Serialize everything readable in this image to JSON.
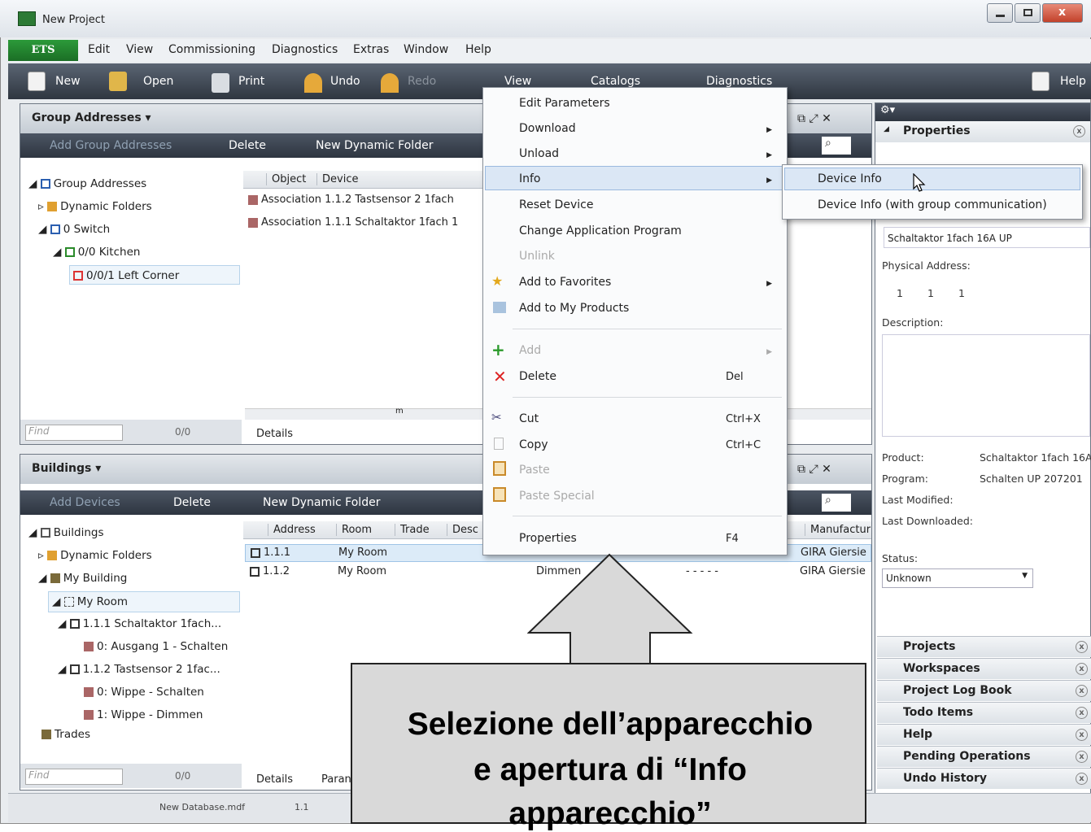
{
  "window": {
    "title": "New Project"
  },
  "menubar": {
    "ets": "ETS",
    "items": [
      "Edit",
      "View",
      "Commissioning",
      "Diagnostics",
      "Extras",
      "Window",
      "Help"
    ]
  },
  "toolbar": {
    "new": "New",
    "open": "Open",
    "print": "Print",
    "undo": "Undo",
    "redo": "Redo",
    "view": "View",
    "catalogs": "Catalogs",
    "diagnostics": "Diagnostics",
    "help": "Help"
  },
  "group_panel": {
    "title": "Group Addresses",
    "add": "Add Group Addresses",
    "delete": "Delete",
    "new_folder": "New Dynamic Folder",
    "tree": [
      "Group Addresses",
      "Dynamic Folders",
      "0 Switch",
      "0/0 Kitchen",
      "0/0/1 Left Corner"
    ],
    "columns": [
      "Object",
      "Device"
    ],
    "rows": [
      "Association 1.1.2  Tastsensor 2 1fach",
      "Association 1.1.1  Schaltaktor 1fach 1"
    ],
    "find": "Find",
    "count": "0/0",
    "tab": "Details",
    "scroll_mark": "m"
  },
  "buildings_panel": {
    "title": "Buildings",
    "add": "Add Devices",
    "delete": "Delete",
    "new_folder": "New Dynamic Folder",
    "tree": [
      "Buildings",
      "Dynamic Folders",
      "My Building",
      "My Room",
      "1.1.1  Schaltaktor 1fach...",
      "0: Ausgang 1 - Schalten",
      "1.1.2  Tastsensor 2 1fac...",
      "0: Wippe - Schalten",
      "1: Wippe - Dimmen",
      "Trades"
    ],
    "columns": [
      "Address",
      "Room",
      "Trade",
      "Desc",
      "Manufactur"
    ],
    "rows": [
      {
        "address": "1.1.1",
        "room": "My Room",
        "manufacturer": "GIRA Giersie"
      },
      {
        "address": "1.1.2",
        "room": "My Room",
        "desc": "Dimmen",
        "dashes": "-  -  -  -  -",
        "manufacturer": "GIRA Giersie"
      }
    ],
    "find": "Find",
    "count": "0/0",
    "tabs": [
      "Details",
      "Paran"
    ]
  },
  "context_menu": {
    "items": [
      "Edit Parameters",
      "Download",
      "Unload",
      "Info",
      "Reset Device",
      "Change Application Program",
      "Unlink",
      "Add to Favorites",
      "Add to My Products",
      "Add",
      "Delete",
      "Cut",
      "Copy",
      "Paste",
      "Paste Special",
      "Properties"
    ],
    "shortcuts": {
      "delete": "Del",
      "cut": "Ctrl+X",
      "copy": "Ctrl+C",
      "properties": "F4"
    }
  },
  "submenu": {
    "items": [
      "Device Info",
      "Device Info (with group communication)"
    ]
  },
  "properties": {
    "title": "Properties",
    "name": "Schaltaktor 1fach 16A UP",
    "physical_label": "Physical Address:",
    "physical": [
      "1",
      "1",
      "1"
    ],
    "description_label": "Description:",
    "product_label": "Product:",
    "product": "Schaltaktor 1fach 16A",
    "program_label": "Program:",
    "program": "Schalten UP 207201",
    "last_modified": "Last Modified:",
    "last_downloaded": "Last Downloaded:",
    "status_label": "Status:",
    "status": "Unknown"
  },
  "accordion": [
    "Projects",
    "Workspaces",
    "Project Log Book",
    "Todo Items",
    "Help",
    "Pending Operations",
    "Undo History"
  ],
  "statusbar": {
    "db": "New Database.mdf",
    "addr": "1.1"
  },
  "callout": {
    "line1": "Selezione dell’apparecchio",
    "line2": "e apertura di “Info",
    "line3": "apparecchio”"
  }
}
